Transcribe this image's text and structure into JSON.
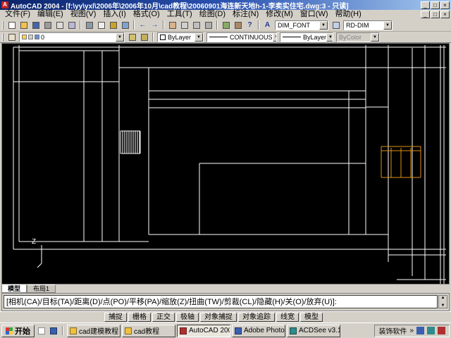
{
  "titlebar": {
    "title": "AutoCAD 2004 - [f:\\yy\\yxl\\2006年\\2006年10月\\cad教程\\20060901海连新天地h-1-李卖实住宅.dwg:3 - 只读]"
  },
  "ui": {
    "min": "_",
    "max": "□",
    "close": "×",
    "dropdown": "▼",
    "scroll_up": "▲",
    "scroll_down": "▼",
    "chevron": "»",
    "undo_glyph": "←",
    "redo_glyph": "→",
    "help_glyph": "?"
  },
  "menubar": {
    "items": [
      "文件(F)",
      "编辑(E)",
      "视图(V)",
      "插入(I)",
      "格式(O)",
      "工具(T)",
      "绘图(D)",
      "标注(N)",
      "修改(M)",
      "窗口(W)",
      "帮助(H)"
    ]
  },
  "toolbar1": {
    "text_style": "DIM_FONT",
    "dim_style": "RD-DIM",
    "text_style_icon_glyph": "A"
  },
  "toolbar2": {
    "layer_name": "0",
    "color": "ByLayer",
    "linetype": "CONTINUOUS",
    "lineweight": "ByLayer",
    "plotstyle": "ByColor"
  },
  "icons": {
    "row1": [
      "new",
      "open",
      "save",
      "plot",
      "plot-preview",
      "publish",
      "cut",
      "copy",
      "paste",
      "match-properties",
      "undo",
      "redo",
      "pan-realtime",
      "zoom-realtime",
      "zoom-window",
      "zoom-previous",
      "properties",
      "designcenter",
      "help"
    ],
    "row2": [
      "layers",
      "make-object-layer-current",
      "layer-previous"
    ]
  },
  "drawing": {
    "z_label": "Z"
  },
  "colors": {
    "wireframe": "#ffffff",
    "highlight": "#e09114",
    "canvas": "#000000"
  },
  "tabs": {
    "model": "模型",
    "layout1": "布局1"
  },
  "command": {
    "prompt": "[相机(CA)/目标(TA)/距离(D)/点(PO)/平移(PA)/缩放(Z)/扭曲(TW)/剪裁(CL)/隐藏(H)/关(O)/放弃(U)]:"
  },
  "statusbar": {
    "toggles": [
      "捕捉",
      "栅格",
      "正交",
      "极轴",
      "对象捕捉",
      "对象追踪",
      "线宽",
      "模型"
    ]
  },
  "taskbar": {
    "start": "开始",
    "tasks": [
      "cad建模教程",
      "cad教程",
      "AutoCAD 200...",
      "Adobe Photo...",
      "ACDSee v3.1..."
    ],
    "tray_label": "装饰软件"
  }
}
